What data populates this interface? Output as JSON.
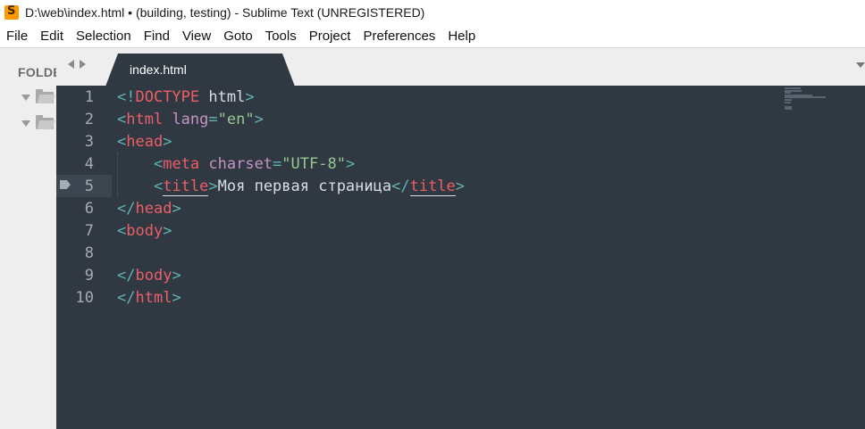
{
  "window": {
    "title": "D:\\web\\index.html • (building, testing) - Sublime Text (UNREGISTERED)"
  },
  "menu": {
    "items": [
      "File",
      "Edit",
      "Selection",
      "Find",
      "View",
      "Goto",
      "Tools",
      "Project",
      "Preferences",
      "Help"
    ]
  },
  "sidebar": {
    "heading": "FOLDERS",
    "folders": [
      {
        "icon": "folder-icon",
        "expanded": true
      },
      {
        "icon": "folder-icon",
        "expanded": true
      }
    ]
  },
  "tabs": [
    {
      "label": "index.html",
      "dirty": true,
      "active": true
    }
  ],
  "editor": {
    "current_line": 5,
    "line_numbers": [
      "1",
      "2",
      "3",
      "4",
      "5",
      "6",
      "7",
      "8",
      "9",
      "10"
    ],
    "lines": [
      [
        {
          "t": "<!",
          "c": "punct"
        },
        {
          "t": "DOCTYPE",
          "c": "tagname"
        },
        {
          "t": " html",
          "c": "plain"
        },
        {
          "t": ">",
          "c": "punct"
        }
      ],
      [
        {
          "t": "<",
          "c": "punct"
        },
        {
          "t": "html",
          "c": "tagname"
        },
        {
          "t": " lang",
          "c": "attr"
        },
        {
          "t": "=",
          "c": "punct"
        },
        {
          "t": "\"en\"",
          "c": "str"
        },
        {
          "t": ">",
          "c": "punct"
        }
      ],
      [
        {
          "t": "<",
          "c": "punct"
        },
        {
          "t": "head",
          "c": "tagname"
        },
        {
          "t": ">",
          "c": "punct"
        }
      ],
      [
        {
          "t": "    ",
          "c": "plain"
        },
        {
          "t": "<",
          "c": "punct"
        },
        {
          "t": "meta",
          "c": "tagname"
        },
        {
          "t": " charset",
          "c": "attr"
        },
        {
          "t": "=",
          "c": "punct"
        },
        {
          "t": "\"UTF-8\"",
          "c": "str"
        },
        {
          "t": ">",
          "c": "punct"
        }
      ],
      [
        {
          "t": "    ",
          "c": "plain"
        },
        {
          "t": "<",
          "c": "punct"
        },
        {
          "t": "title",
          "c": "tagname matched"
        },
        {
          "t": ">",
          "c": "punct"
        },
        {
          "t": "Моя первая страница",
          "c": "plain"
        },
        {
          "t": "</",
          "c": "punct"
        },
        {
          "t": "title",
          "c": "tagname matched"
        },
        {
          "t": ">",
          "c": "punct"
        }
      ],
      [
        {
          "t": "</",
          "c": "punct"
        },
        {
          "t": "head",
          "c": "tagname"
        },
        {
          "t": ">",
          "c": "punct"
        }
      ],
      [
        {
          "t": "<",
          "c": "punct"
        },
        {
          "t": "body",
          "c": "tagname"
        },
        {
          "t": ">",
          "c": "punct"
        }
      ],
      [],
      [
        {
          "t": "</",
          "c": "punct"
        },
        {
          "t": "body",
          "c": "tagname"
        },
        {
          "t": ">",
          "c": "punct"
        }
      ],
      [
        {
          "t": "</",
          "c": "punct"
        },
        {
          "t": "html",
          "c": "tagname"
        },
        {
          "t": ">",
          "c": "punct"
        }
      ]
    ]
  },
  "colors": {
    "editor_background": "#303841",
    "tag": "#ec5f66",
    "punctuation": "#5fb3b3",
    "attribute": "#c594c5",
    "string": "#99c794",
    "text": "#d8dee9",
    "line_number": "#a6acb5",
    "sidebar_background": "#eeeeee"
  }
}
